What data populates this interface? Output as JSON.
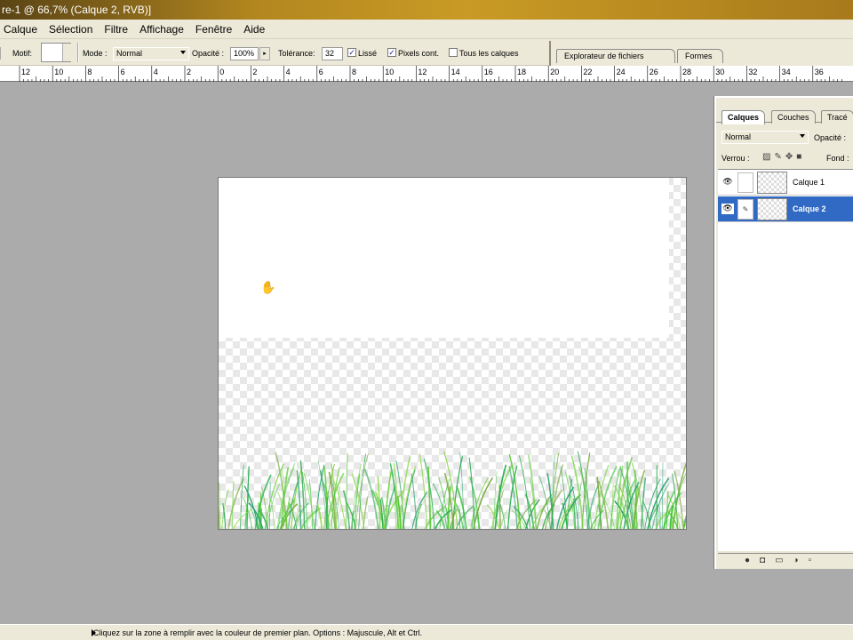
{
  "window": {
    "title": "re-1 @ 66,7% (Calque 2, RVB)]"
  },
  "menu": {
    "items": [
      "Calque",
      "Sélection",
      "Filtre",
      "Affichage",
      "Fenêtre",
      "Aide"
    ]
  },
  "options": {
    "motif_label": "Motif:",
    "mode_label": "Mode :",
    "mode_value": "Normal",
    "opacity_label": "Opacité :",
    "opacity_value": "100%",
    "tolerance_label": "Tolérance:",
    "tolerance_value": "32",
    "lisse_label": "Lissé",
    "lisse_checked": true,
    "pixels_label": "Pixels cont.",
    "pixels_checked": true,
    "tous_label": "Tous les calques",
    "tous_checked": false
  },
  "palette_well": {
    "tabs": [
      "Explorateur de fichiers",
      "Formes"
    ]
  },
  "ruler": {
    "labels": [
      "12",
      "10",
      "8",
      "6",
      "4",
      "2",
      "0",
      "2",
      "4",
      "6",
      "8",
      "10",
      "12",
      "14",
      "16",
      "18",
      "20",
      "22",
      "24",
      "26",
      "28",
      "30",
      "32",
      "34",
      "36"
    ]
  },
  "layers_palette": {
    "tabs": [
      "Calques",
      "Couches",
      "Tracé"
    ],
    "blend_mode": "Normal",
    "opacity_label": "Opacité :",
    "lock_label": "Verrou :",
    "fill_label": "Fond :",
    "layers": [
      {
        "name": "Calque 1",
        "selected": false
      },
      {
        "name": "Calque 2",
        "selected": true
      }
    ]
  },
  "status": {
    "text": "Cliquez sur la zone à remplir avec la couleur de premier plan. Options : Majuscule, Alt et Ctrl."
  },
  "colors": {
    "title_gradient": "#c99a25",
    "selection": "#316ac5",
    "chrome": "#ece9d8",
    "workspace": "#ababab"
  }
}
